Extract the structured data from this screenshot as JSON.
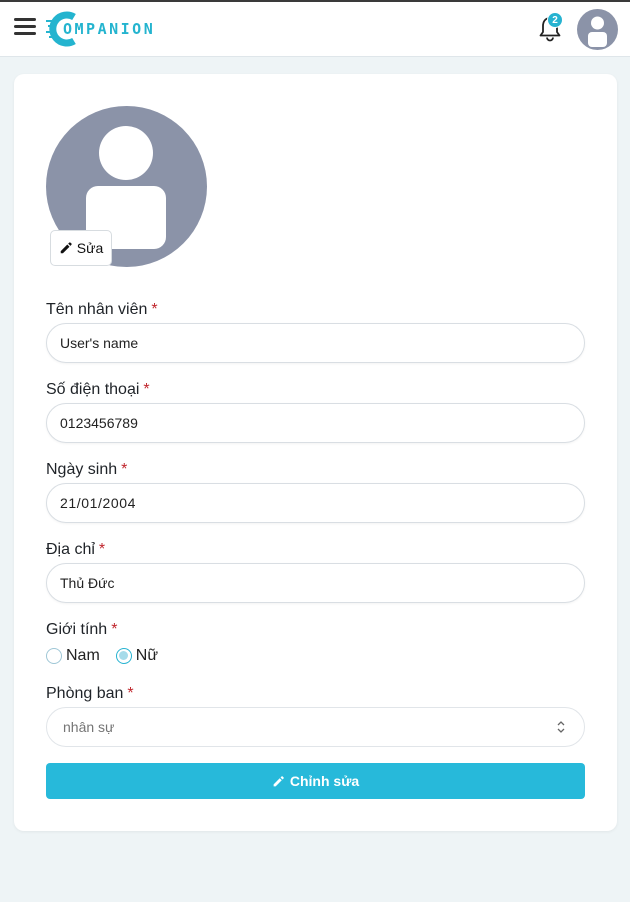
{
  "header": {
    "logo_text": "OMPANION",
    "notification_count": "2"
  },
  "profile": {
    "edit_avatar_label": "Sửa"
  },
  "form": {
    "name": {
      "label": "Tên nhân viên",
      "required_mark": "*",
      "value": "User's name"
    },
    "phone": {
      "label": "Số điện thoại",
      "required_mark": "*",
      "value": "0123456789"
    },
    "birthday": {
      "label": "Ngày sinh",
      "required_mark": "*",
      "value": "21/01/2004"
    },
    "address": {
      "label": "Địa chỉ",
      "required_mark": "*",
      "value": "Thủ Đức"
    },
    "gender": {
      "label": "Giới tính",
      "required_mark": "*",
      "options": [
        "Nam",
        "Nữ"
      ],
      "selected": "Nữ"
    },
    "department": {
      "label": "Phòng ban",
      "required_mark": "*",
      "value": "nhân sự"
    },
    "submit_label": "Chỉnh sửa"
  },
  "colors": {
    "accent": "#27b9da",
    "avatar_bg": "#8b93a8",
    "required": "#c0262d",
    "page_bg": "#eef4f6"
  }
}
